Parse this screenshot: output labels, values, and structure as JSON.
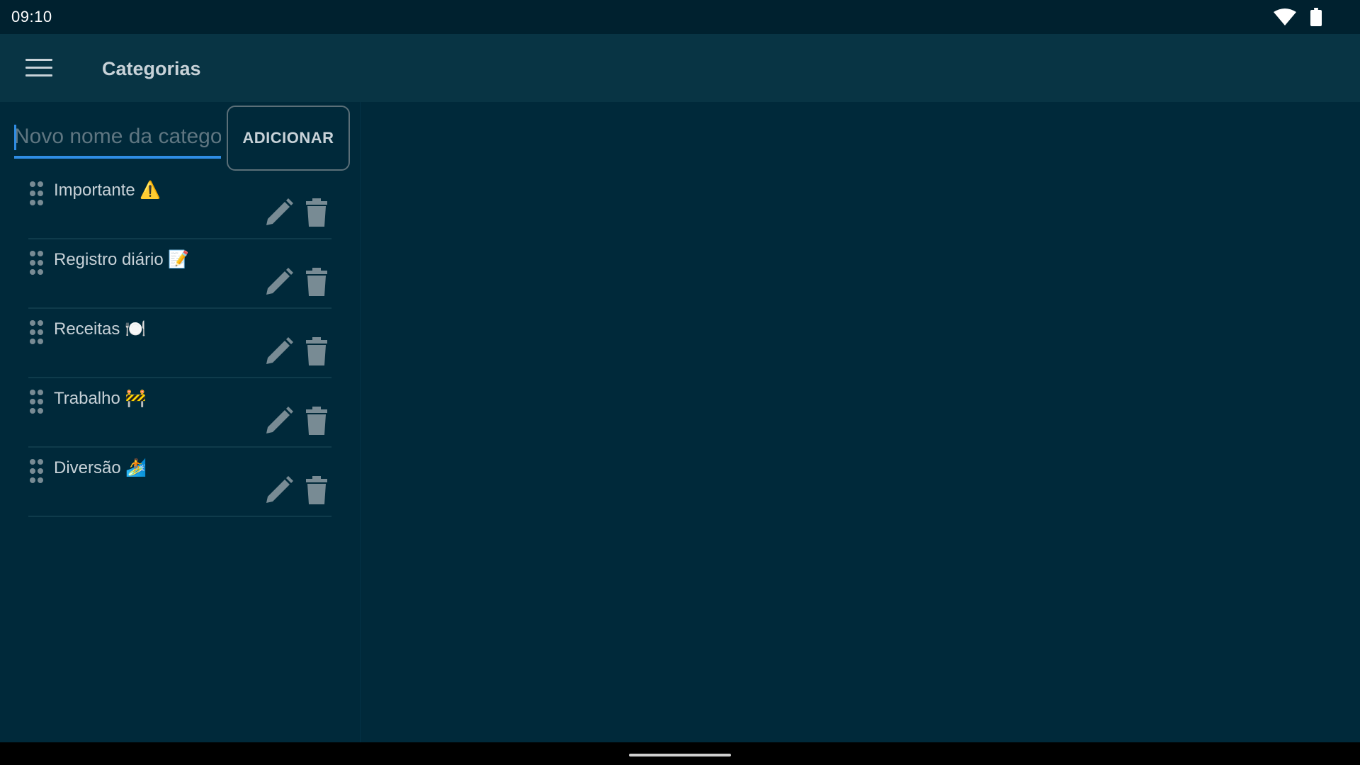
{
  "status": {
    "time": "09:10"
  },
  "app_bar": {
    "title": "Categorias",
    "menu_icon": "menu-icon"
  },
  "new_category": {
    "placeholder": "Novo nome da categoria",
    "value": "",
    "add_label": "ADICIONAR"
  },
  "categories": [
    {
      "name": "Importante ⚠️"
    },
    {
      "name": "Registro diário 📝"
    },
    {
      "name": "Receitas 🍽️"
    },
    {
      "name": "Trabalho 🚧"
    },
    {
      "name": "Diversão 🏄"
    }
  ],
  "colors": {
    "background": "#00293a",
    "app_bar": "#083444",
    "status_bar": "#00212f",
    "accent": "#2f8de4",
    "text": "#c8d2d8",
    "icon": "#788b94"
  }
}
